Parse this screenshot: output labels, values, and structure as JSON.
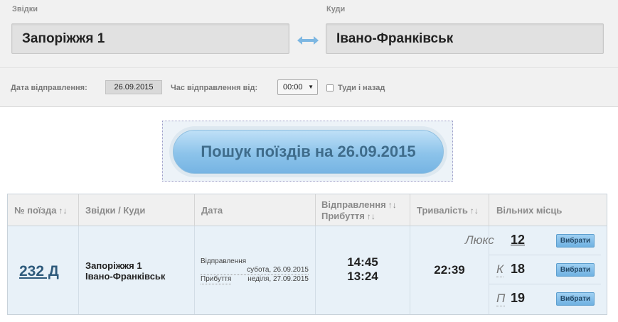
{
  "route": {
    "from_label": "Звідки",
    "to_label": "Куди",
    "from_value": "Запоріжжя 1",
    "to_value": "Івано-Франківськ"
  },
  "date_panel": {
    "date_label": "Дата відправлення:",
    "date_value": "26.09.2015",
    "time_label": "Час відправлення від:",
    "time_value": "00:00",
    "round_trip_label": "Туди і назад",
    "round_trip_checked": false
  },
  "search": {
    "button_label": "Пошук поїздів на 26.09.2015"
  },
  "table": {
    "headers": {
      "train_no": "№ поїзда",
      "from_to": "Звідки / Куди",
      "date": "Дата",
      "departure": "Відправлення",
      "arrival": "Прибуття",
      "duration": "Тривалість",
      "seats": "Вільних місць"
    },
    "sort_glyph": "↑↓",
    "rows": [
      {
        "train_no": "232 Д",
        "from": "Запоріжжя 1",
        "to": "Івано-Франківськ",
        "departure_label": "Відправлення",
        "departure_date": "субота, 26.09.2015",
        "arrival_label": "Прибуття",
        "arrival_date": "неділя, 27.09.2015",
        "departure_time": "14:45",
        "arrival_time": "13:24",
        "duration": "22:39",
        "seats": [
          {
            "class": "Люкс",
            "count": "12",
            "button": "Вибрати"
          },
          {
            "class": "К",
            "count": "18",
            "button": "Вибрати"
          },
          {
            "class": "П",
            "count": "19",
            "button": "Вибрати"
          }
        ]
      }
    ]
  },
  "colors": {
    "accent": "#8cc3ea",
    "link": "#2f5b7c",
    "row_bg": "#e8f1f8"
  }
}
